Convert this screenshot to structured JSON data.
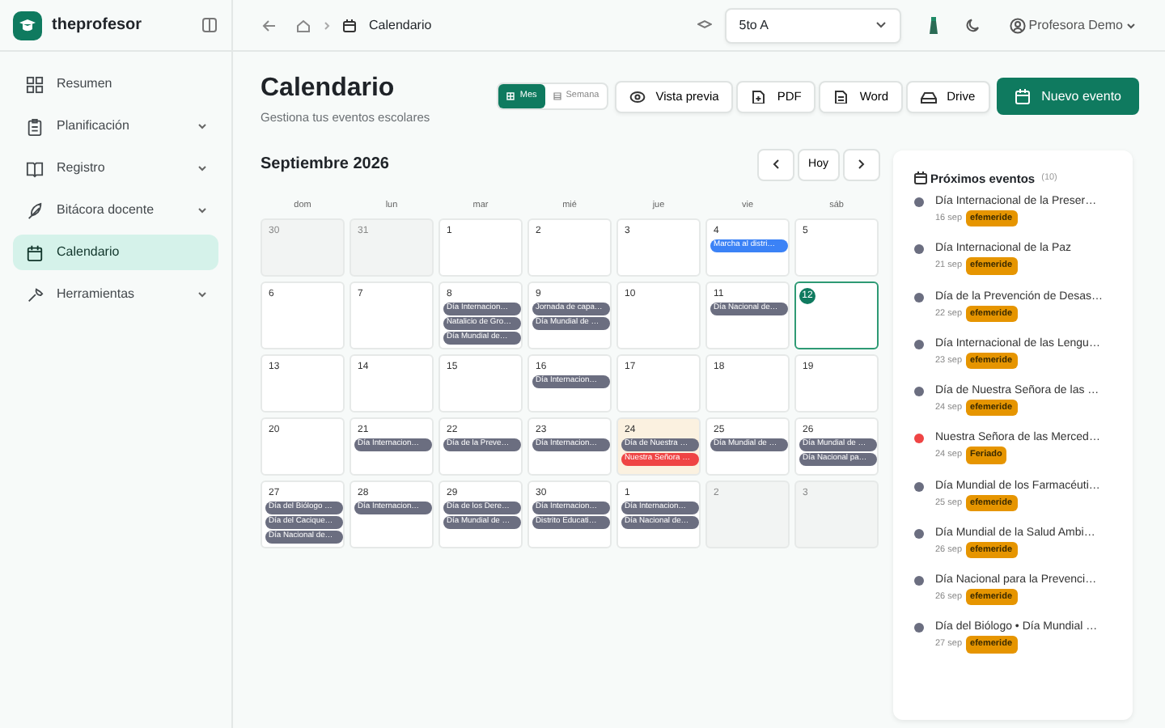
{
  "brand": "theprofesor",
  "sidebar": {
    "items": [
      {
        "label": "Resumen",
        "has_submenu": false,
        "selected": false
      },
      {
        "label": "Planificación",
        "has_submenu": true,
        "selected": false
      },
      {
        "label": "Registro",
        "has_submenu": true,
        "selected": false
      },
      {
        "label": "Bitácora docente",
        "has_submenu": true,
        "selected": false
      },
      {
        "label": "Calendario",
        "has_submenu": false,
        "selected": true
      },
      {
        "label": "Herramientas",
        "has_submenu": true,
        "selected": false
      }
    ]
  },
  "topbar": {
    "breadcrumb": "Calendario",
    "class_select": {
      "value": "5to A"
    },
    "user": "Profesora Demo"
  },
  "header": {
    "title": "Calendario",
    "subtitle": "Gestiona tus eventos escolares",
    "view_toggle": [
      {
        "label": "Mes",
        "selected": true
      },
      {
        "label": "Semana",
        "selected": false
      }
    ],
    "buttons": [
      "Vista previa",
      "PDF",
      "Word",
      "Drive"
    ],
    "primary_button": "Nuevo evento"
  },
  "calendar": {
    "month": "Septiembre 2026",
    "today_button": "Hoy",
    "weekdays": [
      "dom",
      "lun",
      "mar",
      "mié",
      "jue",
      "vie",
      "sáb"
    ],
    "weeks": [
      [
        {
          "day": "30",
          "outside": true,
          "today": false,
          "highlight": false
        },
        {
          "day": "31",
          "outside": true,
          "today": false,
          "highlight": false
        },
        {
          "day": "1",
          "outside": false,
          "today": false,
          "highlight": false
        },
        {
          "day": "2",
          "outside": false,
          "today": false,
          "highlight": false
        },
        {
          "day": "3",
          "outside": false,
          "today": false,
          "highlight": false
        },
        {
          "day": "4",
          "outside": false,
          "today": false,
          "highlight": false,
          "events": [
            {
              "label": "Marcha al distri…",
              "color": "#3b82f6"
            }
          ]
        },
        {
          "day": "5",
          "outside": false,
          "today": false,
          "highlight": false
        }
      ],
      [
        {
          "day": "6",
          "outside": false,
          "today": false,
          "highlight": false
        },
        {
          "day": "7",
          "outside": false,
          "today": false,
          "highlight": false
        },
        {
          "day": "8",
          "outside": false,
          "today": false,
          "highlight": false,
          "events": [
            {
              "label": "Día Internacion…",
              "color": "#6b6e80"
            },
            {
              "label": "Natalicio de Gro…",
              "color": "#6b6e80"
            },
            {
              "label": "Día Mundial de…",
              "color": "#6b6e80"
            }
          ]
        },
        {
          "day": "9",
          "outside": false,
          "today": false,
          "highlight": false,
          "events": [
            {
              "label": "Jornada de capa…",
              "color": "#6b6e80"
            },
            {
              "label": "Día Mundial de …",
              "color": "#6b6e80"
            }
          ]
        },
        {
          "day": "10",
          "outside": false,
          "today": false,
          "highlight": false
        },
        {
          "day": "11",
          "outside": false,
          "today": false,
          "highlight": false,
          "events": [
            {
              "label": "Día Nacional de…",
              "color": "#6b6e80"
            }
          ]
        },
        {
          "day": "12",
          "outside": false,
          "today": true,
          "highlight": false
        }
      ],
      [
        {
          "day": "13",
          "outside": false,
          "today": false,
          "highlight": false
        },
        {
          "day": "14",
          "outside": false,
          "today": false,
          "highlight": false
        },
        {
          "day": "15",
          "outside": false,
          "today": false,
          "highlight": false
        },
        {
          "day": "16",
          "outside": false,
          "today": false,
          "highlight": false,
          "events": [
            {
              "label": "Día Internacion…",
              "color": "#6b6e80"
            }
          ]
        },
        {
          "day": "17",
          "outside": false,
          "today": false,
          "highlight": false
        },
        {
          "day": "18",
          "outside": false,
          "today": false,
          "highlight": false
        },
        {
          "day": "19",
          "outside": false,
          "today": false,
          "highlight": false
        }
      ],
      [
        {
          "day": "20",
          "outside": false,
          "today": false,
          "highlight": false
        },
        {
          "day": "21",
          "outside": false,
          "today": false,
          "highlight": false,
          "events": [
            {
              "label": "Día Internacion…",
              "color": "#6b6e80"
            }
          ]
        },
        {
          "day": "22",
          "outside": false,
          "today": false,
          "highlight": false,
          "events": [
            {
              "label": "Día de la Preve…",
              "color": "#6b6e80"
            }
          ]
        },
        {
          "day": "23",
          "outside": false,
          "today": false,
          "highlight": false,
          "events": [
            {
              "label": "Día Internacion…",
              "color": "#6b6e80"
            }
          ]
        },
        {
          "day": "24",
          "outside": false,
          "today": false,
          "highlight": true,
          "events": [
            {
              "label": "Día de Nuestra …",
              "color": "#6b6e80"
            },
            {
              "label": "Nuestra Señora …",
              "color": "#ef4444"
            }
          ]
        },
        {
          "day": "25",
          "outside": false,
          "today": false,
          "highlight": false,
          "events": [
            {
              "label": "Día Mundial de …",
              "color": "#6b6e80"
            }
          ]
        },
        {
          "day": "26",
          "outside": false,
          "today": false,
          "highlight": false,
          "events": [
            {
              "label": "Día Mundial de …",
              "color": "#6b6e80"
            },
            {
              "label": "Día Nacional pa…",
              "color": "#6b6e80"
            }
          ]
        }
      ],
      [
        {
          "day": "27",
          "outside": false,
          "today": false,
          "highlight": false,
          "events": [
            {
              "label": "Día del Biólogo …",
              "color": "#6b6e80"
            },
            {
              "label": "Día del Cacique…",
              "color": "#6b6e80"
            },
            {
              "label": "Día Nacional de…",
              "color": "#6b6e80"
            }
          ]
        },
        {
          "day": "28",
          "outside": false,
          "today": false,
          "highlight": false,
          "events": [
            {
              "label": "Día Internacion…",
              "color": "#6b6e80"
            }
          ]
        },
        {
          "day": "29",
          "outside": false,
          "today": false,
          "highlight": false,
          "events": [
            {
              "label": "Día de los Dere…",
              "color": "#6b6e80"
            },
            {
              "label": "Día Mundial de …",
              "color": "#6b6e80"
            }
          ]
        },
        {
          "day": "30",
          "outside": false,
          "today": false,
          "highlight": false,
          "events": [
            {
              "label": "Día Internacion…",
              "color": "#6b6e80"
            },
            {
              "label": "Distrito Educati…",
              "color": "#6b6e80"
            }
          ]
        },
        {
          "day": "1",
          "outside": false,
          "today": false,
          "highlight": false,
          "events": [
            {
              "label": "Día Internacion…",
              "color": "#6b6e80"
            },
            {
              "label": "Día Nacional de…",
              "color": "#6b6e80"
            }
          ]
        },
        {
          "day": "2",
          "outside": true,
          "today": false,
          "highlight": false
        },
        {
          "day": "3",
          "outside": true,
          "today": false,
          "highlight": false
        }
      ]
    ]
  },
  "upcoming": {
    "title": "Próximos eventos",
    "count": "(10)",
    "items": [
      {
        "title": "Día Internacional de la Preser…",
        "date": "16 sep",
        "tag": "efemeride",
        "color": "#6b6e80"
      },
      {
        "title": "Día Internacional de la Paz",
        "date": "21 sep",
        "tag": "efemeride",
        "color": "#6b6e80"
      },
      {
        "title": "Día de la Prevención de Desas…",
        "date": "22 sep",
        "tag": "efemeride",
        "color": "#6b6e80"
      },
      {
        "title": "Día Internacional de las Lengu…",
        "date": "23 sep",
        "tag": "efemeride",
        "color": "#6b6e80"
      },
      {
        "title": "Día de Nuestra Señora de las …",
        "date": "24 sep",
        "tag": "efemeride",
        "color": "#6b6e80"
      },
      {
        "title": "Nuestra Señora de las Merced…",
        "date": "24 sep",
        "tag": "Feriado",
        "color": "#ef4444"
      },
      {
        "title": "Día Mundial de los Farmacéuti…",
        "date": "25 sep",
        "tag": "efemeride",
        "color": "#6b6e80"
      },
      {
        "title": "Día Mundial de la Salud Ambi…",
        "date": "26 sep",
        "tag": "efemeride",
        "color": "#6b6e80"
      },
      {
        "title": "Día Nacional para la Prevenci…",
        "date": "26 sep",
        "tag": "efemeride",
        "color": "#6b6e80"
      },
      {
        "title": "Día del Biólogo • Día Mundial …",
        "date": "27 sep",
        "tag": "efemeride",
        "color": "#6b6e80"
      }
    ]
  }
}
